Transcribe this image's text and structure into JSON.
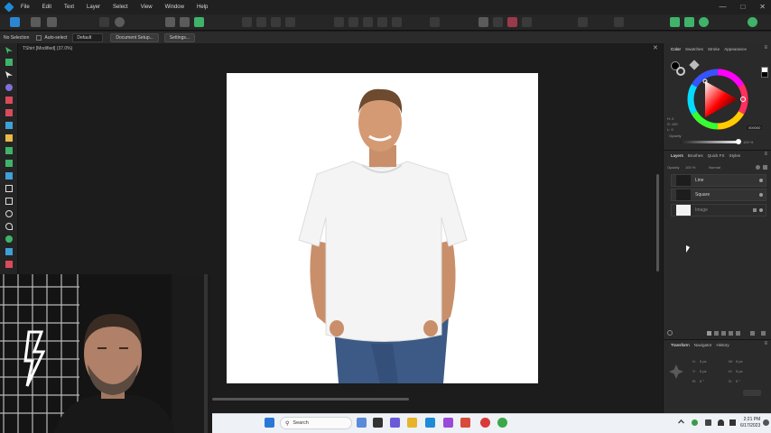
{
  "menubar": {
    "items": [
      "File",
      "Edit",
      "Text",
      "Layer",
      "Select",
      "View",
      "Window",
      "Help"
    ]
  },
  "contextbar": {
    "selection": "No Selection",
    "auto_select_label": "Auto-select",
    "mode_value": "Default",
    "document_setup": "Document Setup...",
    "settings": "Settings..."
  },
  "document": {
    "tab_title": "TShirt [Modified] (37.0%)"
  },
  "color_panel": {
    "tabs": [
      "Color",
      "Swatches",
      "Stroke",
      "Appearance"
    ],
    "hsl": [
      "H: 0",
      "S: 100",
      "L: 0"
    ],
    "hex_value": "000000",
    "opacity_label": "Opacity",
    "opacity_value": "100 %"
  },
  "layers_panel": {
    "tabs": [
      "Layers",
      "Brushes",
      "Quick FX",
      "Styles"
    ],
    "opacity_label": "Opacity",
    "opacity_value": "100 %",
    "blend_mode": "Normal",
    "layers": [
      {
        "name": "Line",
        "type": "shape"
      },
      {
        "name": "Square",
        "type": "shape"
      },
      {
        "name": "Image",
        "type": "image",
        "locked": true
      }
    ]
  },
  "transform_panel": {
    "tabs": [
      "Transform",
      "Navigator",
      "History"
    ],
    "x_label": "X:",
    "x_value": "0 px",
    "y_label": "Y:",
    "y_value": "0 px",
    "w_label": "W:",
    "w_value": "0 px",
    "h_label": "H:",
    "h_value": "0 px",
    "r_label": "R:",
    "r_value": "0 °",
    "s_label": "S:",
    "s_value": "0 °"
  },
  "taskbar": {
    "search_placeholder": "Search",
    "time": "2:21 PM",
    "date": "6/17/2023"
  },
  "colors": {
    "accent": "#1e8bd8",
    "canvas_bg": "#1c1c1c",
    "panel_bg": "#2a2a2a",
    "document_bg": "#ffffff",
    "taskbar_bg": "#eef1f5"
  }
}
